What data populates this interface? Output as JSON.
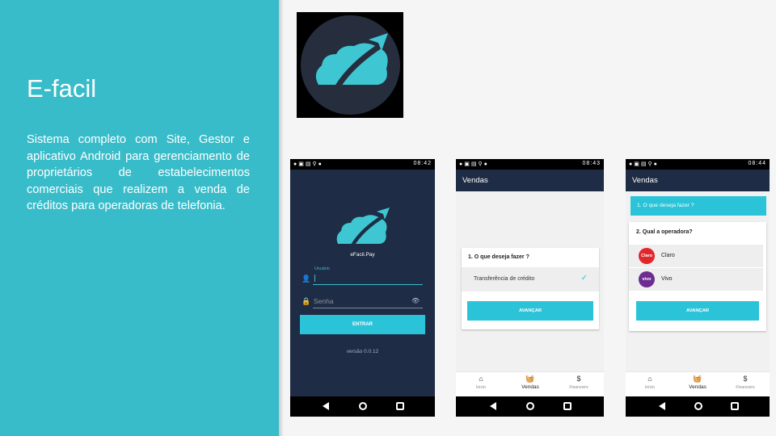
{
  "slide": {
    "title": "E-facil",
    "description": "Sistema completo com Site, Gestor e aplicativo Android para gerenciamento de proprietários de estabelecimentos comerciais que realizem a venda de créditos para operadoras de telefonia."
  },
  "colors": {
    "panel": "#39bcc9",
    "app_dark": "#1f2c45",
    "accent": "#2bc3d8",
    "logo_bg": "#262d3d"
  },
  "phones": {
    "login": {
      "time": "08:42",
      "brand": "eFacil.Pay",
      "username_label": "Usuário",
      "password_placeholder": "Senha",
      "login_button": "ENTRAR",
      "version": "versão 0.0.12"
    },
    "vendas1": {
      "time": "08:43",
      "title": "Vendas",
      "question": "1. O que deseja fazer ?",
      "option": "Transferência de crédito",
      "button": "AVANÇAR",
      "nav": [
        "Início",
        "Vendas",
        "Financeiro"
      ]
    },
    "vendas2": {
      "time": "08:44",
      "title": "Vendas",
      "question1": "1. O que deseja fazer ?",
      "question2": "2. Qual a operadora?",
      "operators": [
        {
          "name": "Claro",
          "logo_text": "Claro",
          "color": "#e3262b"
        },
        {
          "name": "Vivo",
          "logo_text": "vivo",
          "color": "#6c2c91"
        }
      ],
      "button": "AVANÇAR",
      "nav": [
        "Início",
        "Vendas",
        "Financeiro"
      ]
    }
  }
}
